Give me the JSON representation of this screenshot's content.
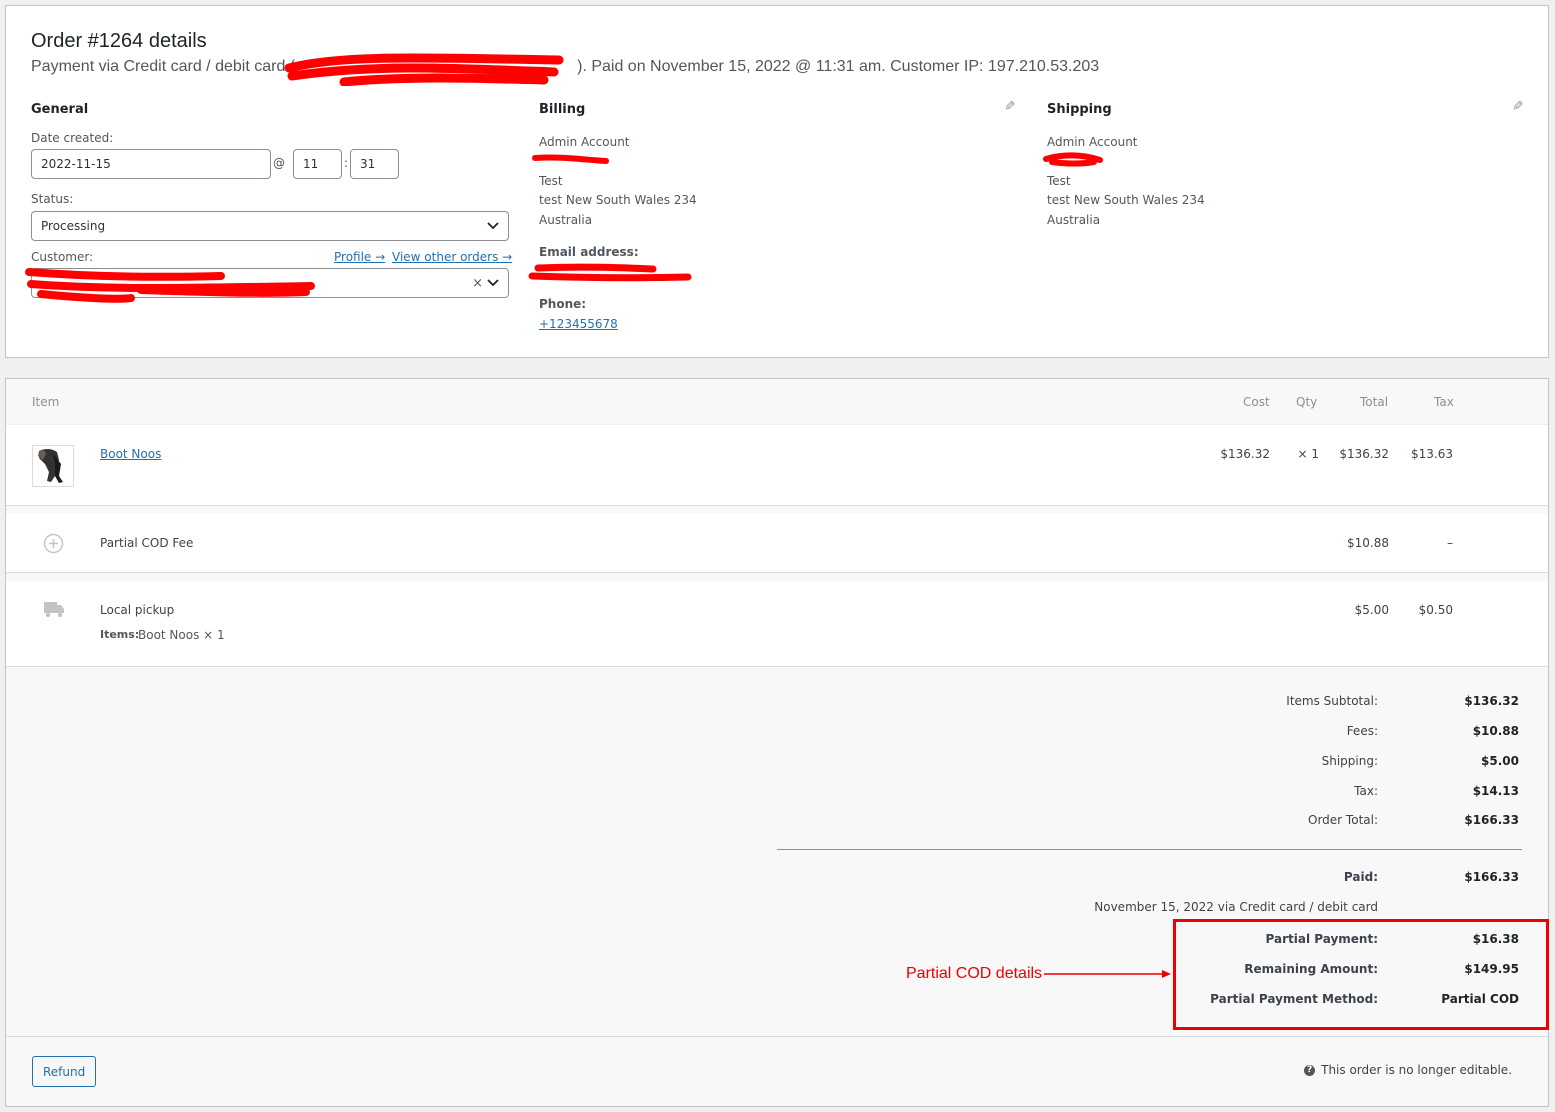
{
  "order": {
    "title": "Order #1264 details",
    "subtitle_prefix": "Payment via Credit card / debit card (",
    "subtitle_suffix": "). Paid on November 15, 2022 @ 11:31 am. Customer IP: 197.210.53.203"
  },
  "general": {
    "heading": "General",
    "date_label": "Date created:",
    "date_value": "2022-11-15",
    "at_sign": "@",
    "hour": "11",
    "colon": ":",
    "minute": "31",
    "status_label": "Status:",
    "status_value": "Processing",
    "customer_label": "Customer:",
    "profile_link": "Profile →",
    "other_orders_link": "View other orders →",
    "clear_symbol": "×"
  },
  "billing": {
    "heading": "Billing",
    "name": "Admin Account",
    "line1": "Test",
    "line2": "test New South Wales 234",
    "line3": "Australia",
    "email_label": "Email address:",
    "phone_label": "Phone:",
    "phone": "+123455678"
  },
  "shipping": {
    "heading": "Shipping",
    "name": "Admin Account",
    "line1": "Test",
    "line2": "test New South Wales 234",
    "line3": "Australia"
  },
  "items_table": {
    "headers": {
      "item": "Item",
      "cost": "Cost",
      "qty": "Qty",
      "total": "Total",
      "tax": "Tax"
    },
    "product": {
      "name": "Boot Noos",
      "cost": "$136.32",
      "qty": "× 1",
      "total": "$136.32",
      "tax": "$13.63"
    },
    "fee": {
      "name": "Partial COD Fee",
      "total": "$10.88",
      "tax": "–"
    },
    "shipping": {
      "name": "Local pickup",
      "items_label": "Items:",
      "items_value": "Boot Noos × 1",
      "total": "$5.00",
      "tax": "$0.50"
    }
  },
  "totals": {
    "items_subtotal_label": "Items Subtotal:",
    "items_subtotal": "$136.32",
    "fees_label": "Fees:",
    "fees": "$10.88",
    "shipping_label": "Shipping:",
    "shipping": "$5.00",
    "tax_label": "Tax:",
    "tax": "$14.13",
    "order_total_label": "Order Total:",
    "order_total": "$166.33",
    "paid_label": "Paid:",
    "paid": "$166.33",
    "paid_note": "November 15, 2022 via Credit card / debit card",
    "partial_payment_label": "Partial Payment:",
    "partial_payment": "$16.38",
    "remaining_label": "Remaining Amount:",
    "remaining": "$149.95",
    "method_label": "Partial Payment Method:",
    "method": "Partial COD"
  },
  "footer": {
    "refund_button": "Refund",
    "help_glyph": "?",
    "not_editable": "This order is no longer editable."
  },
  "annotation": {
    "text": "Partial COD details",
    "color": "#e00000"
  },
  "icons": [
    "edit-pencil-icon",
    "chevron-down-icon",
    "plus-circle-icon",
    "truck-icon",
    "help-icon"
  ]
}
